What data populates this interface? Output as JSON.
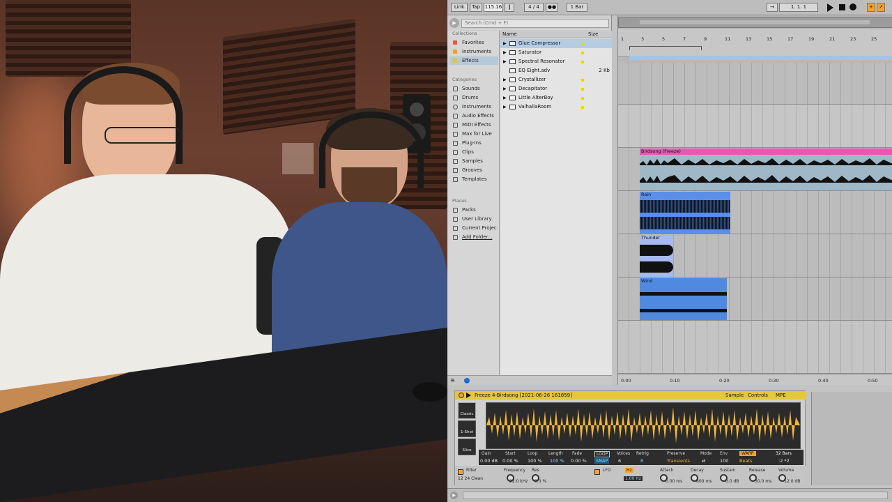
{
  "control_bar": {
    "link": "Link",
    "tap": "Tap",
    "tempo": "115.16",
    "signature": "4 / 4",
    "quantize": "1 Bar",
    "position": "1.   1.   1"
  },
  "browser": {
    "search_placeholder": "Search (Cmd + F)",
    "collections_head": "Collections",
    "collections": [
      {
        "label": "Favorites",
        "color": "#e85a3a"
      },
      {
        "label": "Instruments",
        "color": "#f0a030"
      },
      {
        "label": "Effects",
        "color": "#f0c030"
      }
    ],
    "categories_head": "Categories",
    "categories": [
      "Sounds",
      "Drums",
      "Instruments",
      "Audio Effects",
      "MIDI Effects",
      "Max for Live",
      "Plug-Ins",
      "Clips",
      "Samples",
      "Grooves",
      "Templates"
    ],
    "places_head": "Places",
    "places": [
      "Packs",
      "User Library",
      "Current Projec",
      "Add Folder..."
    ],
    "list_header": {
      "name": "Name",
      "size": "Size"
    },
    "files": [
      {
        "name": "Glue Compressor",
        "size": ""
      },
      {
        "name": "Saturator",
        "size": ""
      },
      {
        "name": "Spectral Resonator",
        "size": ""
      },
      {
        "name": "EQ Eight.adv",
        "size": "2 Kb"
      },
      {
        "name": "Crystallizer",
        "size": ""
      },
      {
        "name": "Decapitator",
        "size": ""
      },
      {
        "name": "Little AlterBoy",
        "size": ""
      },
      {
        "name": "ValhallaRoom",
        "size": ""
      }
    ]
  },
  "arrangement": {
    "bars": [
      "1",
      "3",
      "5",
      "7",
      "9",
      "11",
      "13",
      "15",
      "17",
      "19",
      "21",
      "23",
      "25"
    ],
    "time_labels": [
      "0:00",
      "0:10",
      "0:20",
      "0:30",
      "0:40",
      "0:50"
    ],
    "clips": [
      {
        "name": "Birdsong (Freeze)",
        "color": "#e957b3"
      },
      {
        "name": "Rain",
        "color": "#5a8ee8"
      },
      {
        "name": "Thunder",
        "color": "#a8b8f0"
      },
      {
        "name": "Wind",
        "color": "#4f8ae0"
      }
    ]
  },
  "sample_detail": {
    "title": "Freeze 4-Birdsong [2021-06-26 161859]",
    "tabs": [
      "Sample",
      "Controls",
      "MPE"
    ],
    "modes": [
      "Classic",
      "1-Shot",
      "Slice"
    ],
    "params": [
      {
        "label": "Gain",
        "value": "0.00 dB"
      },
      {
        "label": "Start",
        "value": "0.00 %"
      },
      {
        "label": "Loop",
        "value": "100 %"
      },
      {
        "label": "Length",
        "value": "100 %"
      },
      {
        "label": "Fade",
        "value": "0.00 %"
      },
      {
        "label": "LOOP",
        "value": "SNAP"
      },
      {
        "label": "Voices",
        "value": "6"
      },
      {
        "label": "Retrig",
        "value": "R"
      },
      {
        "label": "Preserve",
        "value": "Transients"
      },
      {
        "label": "Mode",
        "value": "⇄"
      },
      {
        "label": "Env",
        "value": "100"
      },
      {
        "label": "WARP",
        "value": "Beats"
      },
      {
        "label": "32 Bars",
        "value": ":2  *2"
      }
    ],
    "low": [
      {
        "label": "Filter",
        "value": "12 24 Clean"
      },
      {
        "label": "Frequency",
        "value": "22.0 kHz"
      },
      {
        "label": "Res",
        "value": "0.0 %"
      },
      {
        "label": "LFO",
        "value": "Hz"
      },
      {
        "label": "",
        "value": "1.00 Hz"
      },
      {
        "label": "Attack",
        "value": "0.00 ms"
      },
      {
        "label": "Decay",
        "value": "600 ms"
      },
      {
        "label": "Sustain",
        "value": "0.0 dB"
      },
      {
        "label": "Release",
        "value": "50.0 ms"
      },
      {
        "label": "Volume",
        "value": "-12.0 dB"
      }
    ]
  }
}
